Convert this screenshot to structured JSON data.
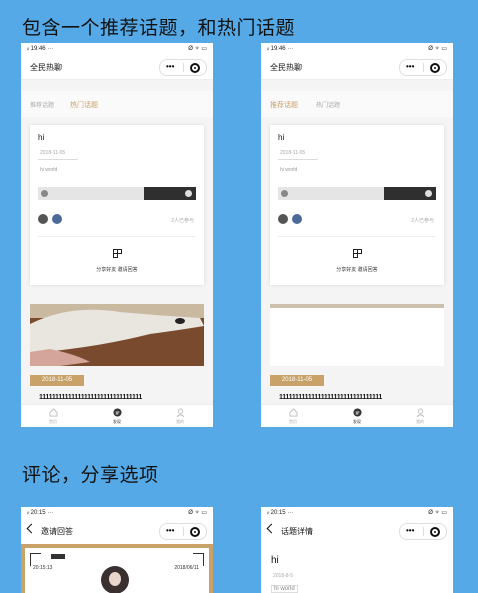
{
  "captions": {
    "top": "包含一个推荐话题，和热门话题",
    "bottom": "评论，分享选项"
  },
  "phone_common": {
    "status_left": "ᵢₗ 19:46 ···",
    "status_right": "Ø ✧ ▭",
    "app_title": "全民热聊",
    "capsule_dots": "•••",
    "tab_recommended": "推荐话题",
    "tab_hot": "热门话题",
    "card_title": "hi",
    "card_date": "2018-11-05",
    "card_body": "hi world",
    "joined_text": "2人已参与",
    "share_text": "分享好友 邀请回答",
    "feed_date": "2018-11-05",
    "feed_text": "11111111111111111111111111111111",
    "nav_home": "首页",
    "nav_discover": "发现",
    "nav_mine": "我的"
  },
  "phone3": {
    "status_left": "ᵢₗ 20:15 ···",
    "status_right": "Ø ✧ ▭",
    "title": "邀请回答",
    "left_time": "20:15:13",
    "right_date": "2018/06/11"
  },
  "phone4": {
    "status_left": "ᵢₗ 20:15 ···",
    "status_right": "Ø ✧ ▭",
    "title": "话题详情",
    "hi": "hi",
    "date": "2018-8-5",
    "body": "hi world"
  },
  "colors": {
    "background": "#54a9e6",
    "accent": "#c9a26a",
    "dark_bar": "#2f2f2f"
  }
}
